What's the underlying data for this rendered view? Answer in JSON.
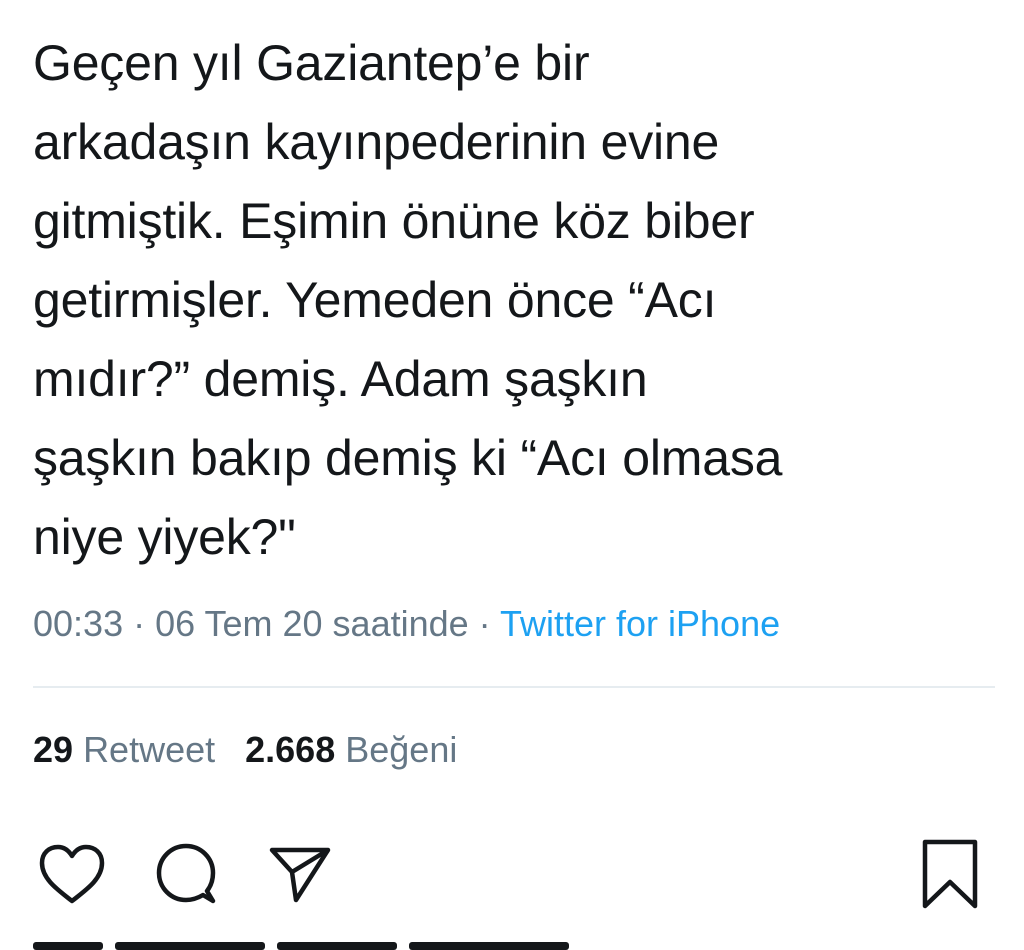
{
  "tweet": {
    "lines": [
      "Geçen yıl Gaziantep’e bir",
      "arkadaşın kayınpederinin evine",
      "gitmiştik. Eşimin önüne köz biber",
      "getirmişler. Yemeden önce “Acı",
      "mıdır?” demiş. Adam şaşkın",
      "şaşkın bakıp demiş ki “Acı olmasa",
      "niye yiyek?\""
    ]
  },
  "meta": {
    "time": "00:33",
    "separator1": " · ",
    "date": "06 Tem 20 saatinde",
    "separator2": " · ",
    "source": "Twitter for iPhone"
  },
  "stats": {
    "retweet_count": "29",
    "retweet_label": "Retweet",
    "like_count": "2.668",
    "like_label": "Beğeni"
  },
  "icons": {
    "like": "heart-icon",
    "reply": "comment-icon",
    "share": "send-icon",
    "bookmark": "bookmark-icon"
  },
  "colors": {
    "text": "#14171a",
    "muted": "#657786",
    "link": "#1da1f2",
    "divider": "#e6ecf0"
  }
}
